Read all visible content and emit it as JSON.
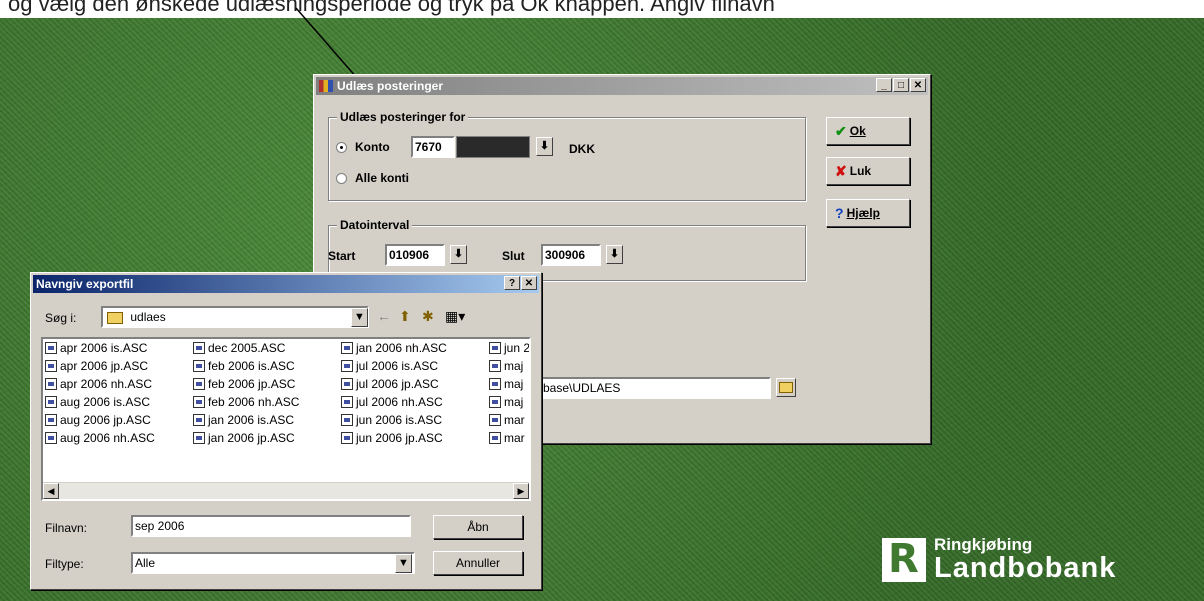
{
  "caption": "og vælg den ønskede udlæsningsperiode og tryk på Ok knappen. Angiv filnavn",
  "main_dialog": {
    "title": "Udlæs posteringer",
    "group1_label": "Udlæs posteringer for",
    "radio_konto": "Konto",
    "konto_value": "7670",
    "currency": "DKK",
    "radio_alle": "Alle konti",
    "group2_label": "Datointerval",
    "start_label": "Start",
    "start_value": "010906",
    "slut_label": "Slut",
    "slut_value": "300906",
    "path_value": "base\\UDLAES",
    "ok_label": "Ok",
    "luk_label": "Luk",
    "help_label": "Hjælp"
  },
  "file_dialog": {
    "title": "Navngiv exportfil",
    "search_label": "Søg i:",
    "folder": "udlaes",
    "columns": [
      [
        "apr 2006 is.ASC",
        "apr 2006 jp.ASC",
        "apr 2006 nh.ASC",
        "aug 2006 is.ASC",
        "aug 2006 jp.ASC",
        "aug 2006 nh.ASC"
      ],
      [
        "dec 2005.ASC",
        "feb 2006 is.ASC",
        "feb 2006 jp.ASC",
        "feb 2006 nh.ASC",
        "jan 2006 is.ASC",
        "jan 2006 jp.ASC"
      ],
      [
        "jan 2006 nh.ASC",
        "jul 2006 is.ASC",
        "jul 2006 jp.ASC",
        "jul 2006 nh.ASC",
        "jun 2006 is.ASC",
        "jun 2006 jp.ASC"
      ],
      [
        "jun 2",
        "maj",
        "maj",
        "maj",
        "mar",
        "mar"
      ]
    ],
    "filename_label": "Filnavn:",
    "filename_value": "sep 2006",
    "filetype_label": "Filtype:",
    "filetype_value": "Alle",
    "open_label": "Åbn",
    "cancel_label": "Annuller"
  },
  "logo": {
    "line1": "Ringkjøbing",
    "line2": "Landbobank"
  },
  "colors": {
    "desktop_green": "#3f7a30",
    "dialog_face": "#d4d0c8",
    "active_title": "#0a246a"
  }
}
